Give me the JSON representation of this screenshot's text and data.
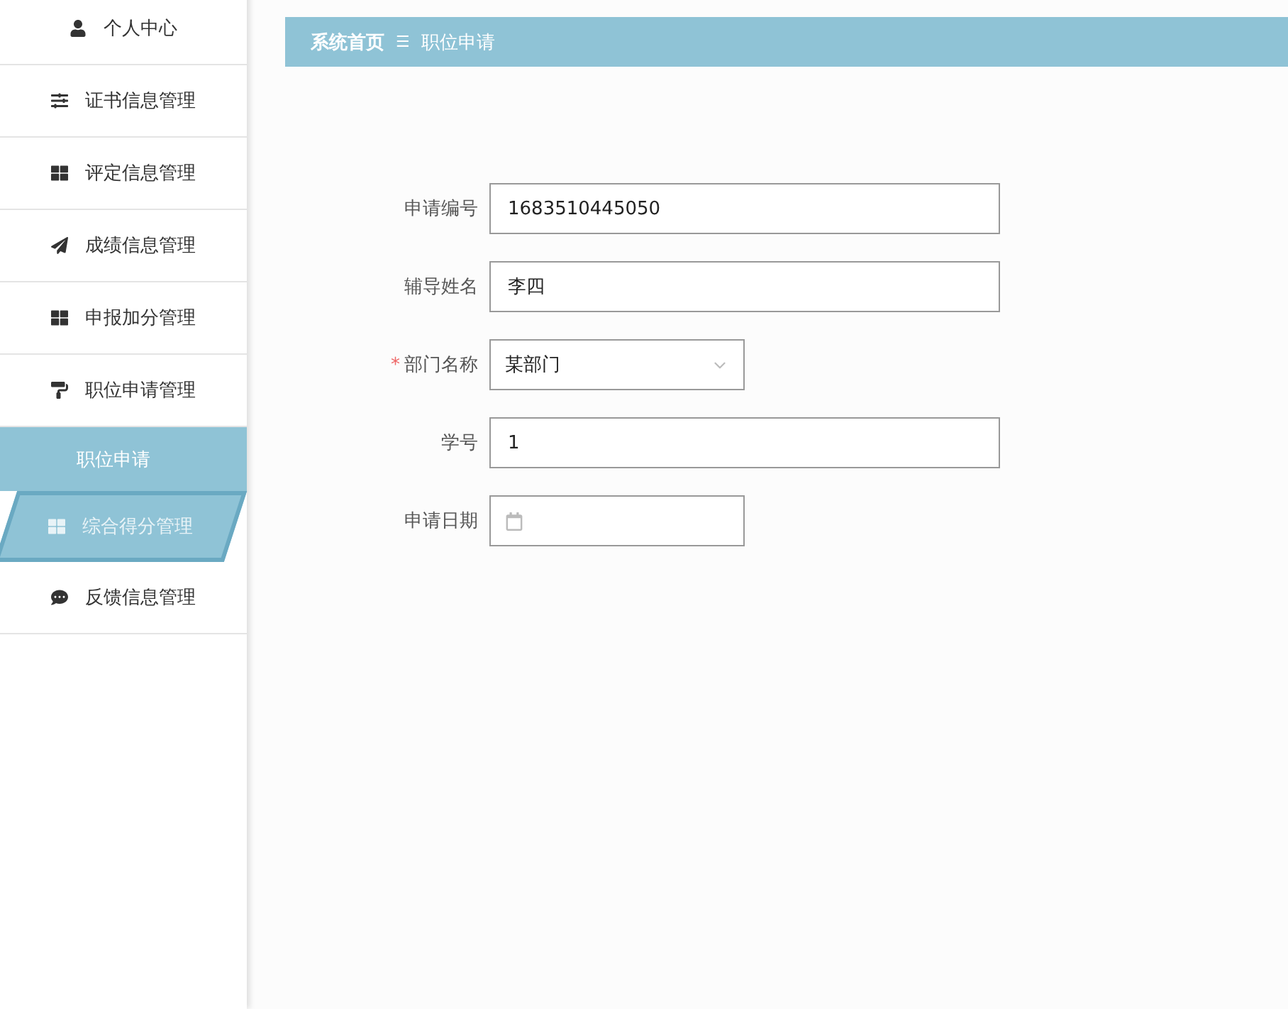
{
  "sidebar": {
    "items": [
      {
        "label": "个人中心",
        "hovered": false
      },
      {
        "label": "证书信息管理",
        "hovered": false
      },
      {
        "label": "评定信息管理",
        "hovered": false
      },
      {
        "label": "成绩信息管理",
        "hovered": false
      },
      {
        "label": "申报加分管理",
        "hovered": false
      },
      {
        "label": "职位申请管理",
        "hovered": false,
        "expanded": true,
        "children": [
          {
            "label": "职位申请",
            "selected": true
          }
        ]
      },
      {
        "label": "综合得分管理",
        "hovered": true
      },
      {
        "label": "反馈信息管理",
        "hovered": false
      }
    ]
  },
  "breadcrumb": {
    "home": "系统首页",
    "separator": "☰",
    "current": "职位申请"
  },
  "form": {
    "fields": [
      {
        "kind": "text",
        "label": "申请编号",
        "value": "1683510445050"
      },
      {
        "kind": "text",
        "label": "辅导姓名",
        "value": "李四"
      },
      {
        "kind": "select",
        "label": "部门名称",
        "value": "某部门",
        "required_mark": "*"
      },
      {
        "kind": "text",
        "label": "学号",
        "value": "1"
      },
      {
        "kind": "date",
        "label": "申请日期"
      }
    ]
  }
}
